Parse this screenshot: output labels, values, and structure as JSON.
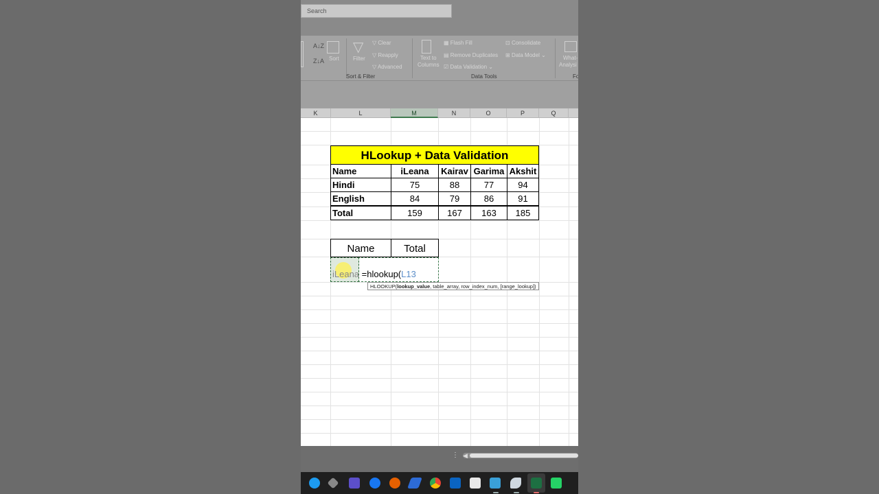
{
  "search": {
    "placeholder": "Search"
  },
  "ribbon": {
    "sort_az": "A↓Z",
    "sort_za": "Z↓A",
    "sort": "Sort",
    "filter": "Filter",
    "clear": "Clear",
    "reapply": "Reapply",
    "advanced": "Advanced",
    "sort_filter_group": "Sort & Filter",
    "text_to_columns_1": "Text to",
    "text_to_columns_2": "Columns",
    "flash_fill": "Flash Fill",
    "remove_duplicates": "Remove Duplicates",
    "data_validation": "Data Validation",
    "consolidate": "Consolidate",
    "data_model": "Data Model",
    "data_tools_group": "Data Tools",
    "what_if_1": "What-",
    "what_if_2": "Analysi",
    "forecast_group": "Fo"
  },
  "columns": [
    "K",
    "L",
    "M",
    "N",
    "O",
    "P",
    "Q"
  ],
  "table": {
    "title": "HLookup + Data Validation",
    "header": [
      "Name",
      "iLeana",
      "Kairav",
      "Garima",
      "Akshit"
    ],
    "rows": [
      [
        "Hindi",
        "75",
        "88",
        "77",
        "94"
      ],
      [
        "English",
        "84",
        "79",
        "86",
        "91"
      ],
      [
        "Total",
        "159",
        "167",
        "163",
        "185"
      ]
    ]
  },
  "lookup": {
    "name_header": "Name",
    "total_header": "Total",
    "name_value": "iLeana",
    "formula_prefix": "=hlookup(",
    "formula_ref": "L13"
  },
  "tooltip": {
    "fn": "HLOOKUP(",
    "arg1": "lookup_value",
    "rest": ", table_array, row_index_num, [range_lookup])"
  },
  "status": {
    "dots": "⋮",
    "arrow": "◀"
  },
  "colors": {
    "title_fill": "#ffff00",
    "active_column": "#3f7b4f",
    "formula_ref": "#5c8ec9"
  },
  "taskbar_icons": [
    "twitter-icon",
    "settings-cube-icon",
    "vs-icon",
    "facebook-icon",
    "firefox-icon",
    "power-automate-icon",
    "chrome-icon",
    "outlook-icon",
    "notepad-icon",
    "snip-icon",
    "feather-icon",
    "excel-icon",
    "whatsapp-icon"
  ]
}
